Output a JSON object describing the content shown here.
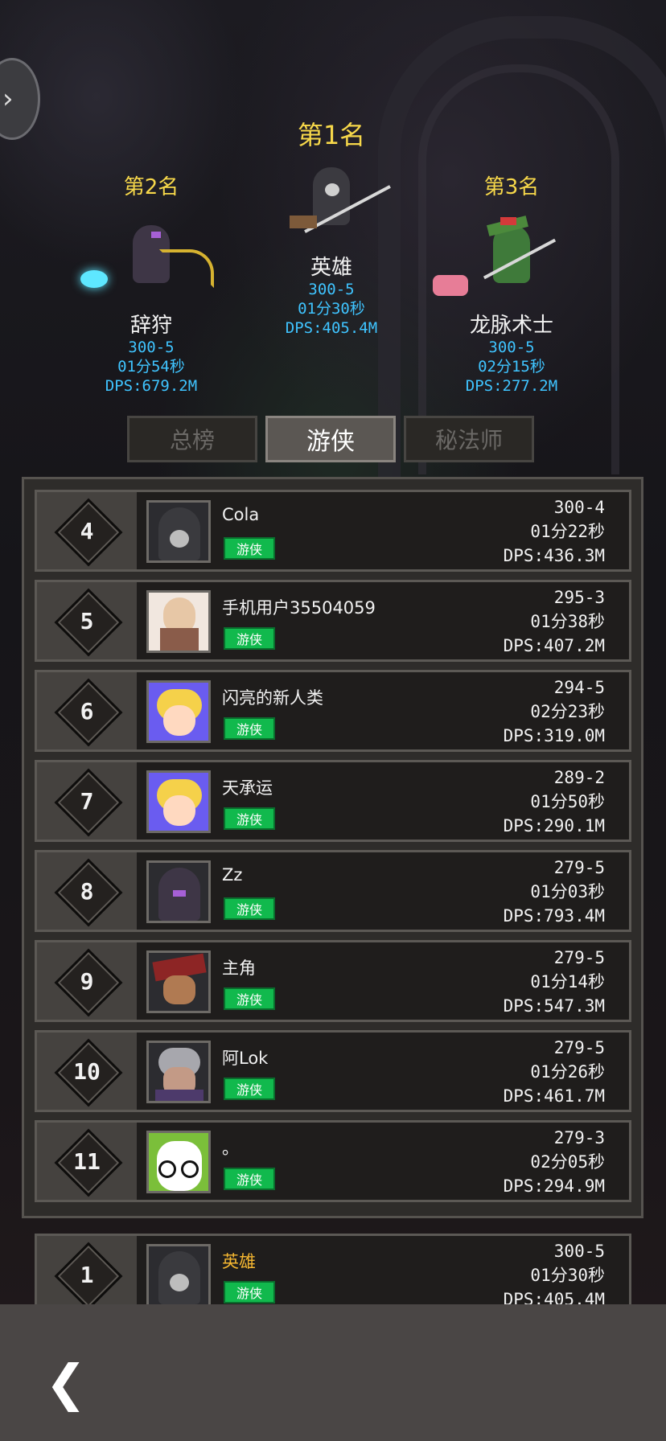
{
  "colors": {
    "gold": "#f7d84a",
    "stat_blue": "#3fc4ff",
    "class_tag_green": "#11b94d",
    "my_name_orange": "#f5b731"
  },
  "nav": {
    "top_left_icon": "chevron-right-icon",
    "back_icon": "chevron-left-icon"
  },
  "podium": [
    {
      "rank_title": "第1名",
      "name": "英雄",
      "level": "300-5",
      "time": "01分30秒",
      "dps": "DPS:405.4M"
    },
    {
      "rank_title": "第2名",
      "name": "辞狩",
      "level": "300-5",
      "time": "01分54秒",
      "dps": "DPS:679.2M"
    },
    {
      "rank_title": "第3名",
      "name": "龙脉术士",
      "level": "300-5",
      "time": "02分15秒",
      "dps": "DPS:277.2M"
    }
  ],
  "tabs": [
    "总榜",
    "游侠",
    "秘法师"
  ],
  "active_tab": "游侠",
  "rows": [
    {
      "rank": "4",
      "name": "Cola",
      "class": "游侠",
      "level": "300-4",
      "time": "01分22秒",
      "dps": "DPS:436.3M"
    },
    {
      "rank": "5",
      "name": "手机用户35504059",
      "class": "游侠",
      "level": "295-3",
      "time": "01分38秒",
      "dps": "DPS:407.2M"
    },
    {
      "rank": "6",
      "name": "闪亮的新人类",
      "class": "游侠",
      "level": "294-5",
      "time": "02分23秒",
      "dps": "DPS:319.0M"
    },
    {
      "rank": "7",
      "name": "天承运",
      "class": "游侠",
      "level": "289-2",
      "time": "01分50秒",
      "dps": "DPS:290.1M"
    },
    {
      "rank": "8",
      "name": "Zz",
      "class": "游侠",
      "level": "279-5",
      "time": "01分03秒",
      "dps": "DPS:793.4M"
    },
    {
      "rank": "9",
      "name": "主角",
      "class": "游侠",
      "level": "279-5",
      "time": "01分14秒",
      "dps": "DPS:547.3M"
    },
    {
      "rank": "10",
      "name": "阿Lok",
      "class": "游侠",
      "level": "279-5",
      "time": "01分26秒",
      "dps": "DPS:461.7M"
    },
    {
      "rank": "11",
      "name": "。",
      "class": "游侠",
      "level": "279-3",
      "time": "02分05秒",
      "dps": "DPS:294.9M"
    }
  ],
  "my_rank": {
    "rank": "1",
    "name": "英雄",
    "class": "游侠",
    "level": "300-5",
    "time": "01分30秒",
    "dps": "DPS:405.4M"
  }
}
